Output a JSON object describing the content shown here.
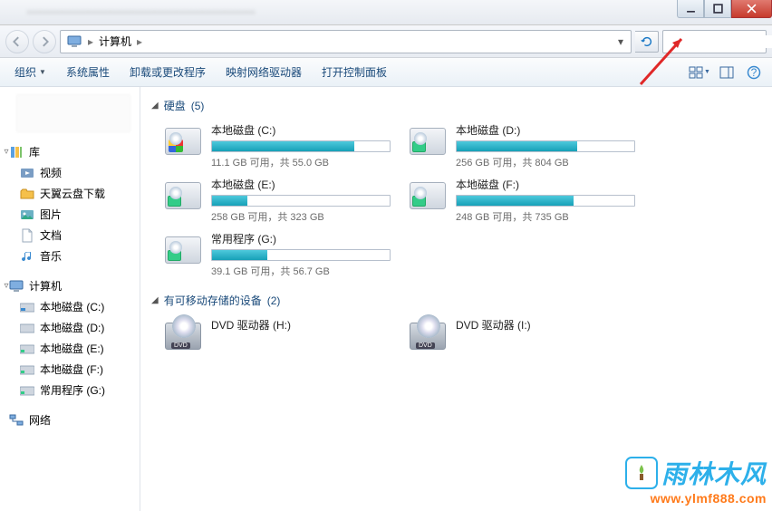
{
  "address": {
    "root": "计算机"
  },
  "search": {
    "placeholder": ""
  },
  "cmdbar": {
    "organize": "组织",
    "sysprops": "系统属性",
    "uninstall": "卸载或更改程序",
    "mapdrive": "映射网络驱动器",
    "controlpanel": "打开控制面板"
  },
  "sidebar": {
    "lib_hdr": "库",
    "items_lib": [
      {
        "label": "视频"
      },
      {
        "label": "天翼云盘下载"
      },
      {
        "label": "图片"
      },
      {
        "label": "文档"
      },
      {
        "label": "音乐"
      }
    ],
    "computer_hdr": "计算机",
    "items_comp": [
      {
        "label": "本地磁盘 (C:)"
      },
      {
        "label": "本地磁盘 (D:)"
      },
      {
        "label": "本地磁盘 (E:)"
      },
      {
        "label": "本地磁盘 (F:)"
      },
      {
        "label": "常用程序 (G:)"
      }
    ],
    "network_hdr": "网络"
  },
  "groups": {
    "hdd": {
      "title": "硬盘",
      "count": "(5)"
    },
    "removable": {
      "title": "有可移动存储的设备",
      "count": "(2)"
    }
  },
  "drives": [
    {
      "name": "本地磁盘 (C:)",
      "text": "11.1 GB 可用，共 55.0 GB",
      "pct": 80,
      "win": true
    },
    {
      "name": "本地磁盘 (D:)",
      "text": "256 GB 可用，共 804 GB",
      "pct": 68,
      "win": false
    },
    {
      "name": "本地磁盘 (E:)",
      "text": "258 GB 可用，共 323 GB",
      "pct": 20,
      "win": false
    },
    {
      "name": "本地磁盘 (F:)",
      "text": "248 GB 可用，共 735 GB",
      "pct": 66,
      "win": false
    },
    {
      "name": "常用程序 (G:)",
      "text": "39.1 GB 可用，共 56.7 GB",
      "pct": 31,
      "win": false
    }
  ],
  "removable": [
    {
      "name": "DVD 驱动器 (H:)"
    },
    {
      "name": "DVD 驱动器 (I:)"
    }
  ],
  "watermark": {
    "brand": "雨林木风",
    "url": "www.ylmf888.com"
  }
}
